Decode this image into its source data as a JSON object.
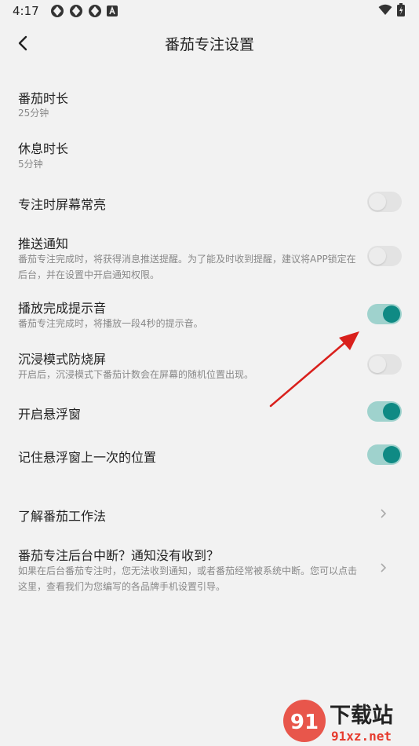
{
  "status_bar": {
    "time": "4:17",
    "icons": [
      "app-notification-icon",
      "app-notification-icon",
      "app-notification-icon",
      "a-badge-icon"
    ],
    "right_icons": [
      "wifi-icon",
      "battery-charging-icon"
    ]
  },
  "header": {
    "title": "番茄专注设置",
    "back_icon": "back-arrow-icon"
  },
  "settings": {
    "pomodoro_duration": {
      "title": "番茄时长",
      "value": "25分钟"
    },
    "rest_duration": {
      "title": "休息时长",
      "value": "5分钟"
    },
    "screen_on": {
      "title": "专注时屏幕常亮",
      "enabled": false
    },
    "push_notify": {
      "title": "推送通知",
      "desc": "番茄专注完成时，将获得消息推送提醒。为了能及时收到提醒，建议将APP锁定在后台，并在设置中开启通知权限。",
      "enabled": false
    },
    "complete_sound": {
      "title": "播放完成提示音",
      "desc": "番茄专注完成时，将播放一段4秒的提示音。",
      "enabled": true
    },
    "immersive_burn": {
      "title": "沉浸模式防烧屏",
      "desc": "开启后，沉浸模式下番茄计数会在屏幕的随机位置出现。",
      "enabled": false
    },
    "floating_window": {
      "title": "开启悬浮窗",
      "enabled": true
    },
    "remember_position": {
      "title": "记住悬浮窗上一次的位置",
      "enabled": true
    },
    "learn_method": {
      "title": "了解番茄工作法"
    },
    "background_help": {
      "title": "番茄专注后台中断？通知没有收到？",
      "desc": "如果在后台番茄专注时，您无法收到通知，或者番茄经常被系统中断。您可以点击这里，查看我们为您编写的各品牌手机设置引导。"
    }
  },
  "watermark": {
    "digits": "91",
    "main": "下载站",
    "domain": "91xz.net"
  },
  "colors": {
    "background": "#f2f2f2",
    "toggle_on_track": "#9fd2cd",
    "toggle_on_knob": "#0f8a84",
    "toggle_off_track": "#e3e3e3",
    "annotation_arrow": "#d9201c"
  }
}
